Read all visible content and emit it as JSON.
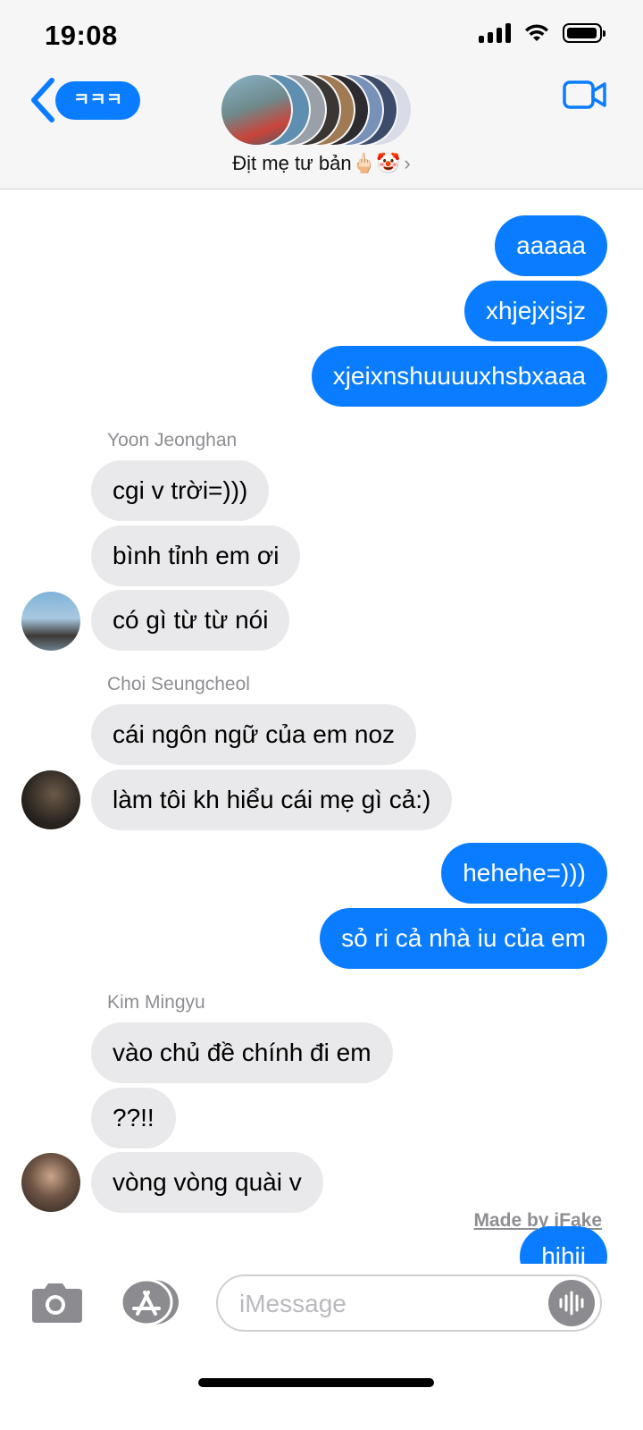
{
  "status": {
    "time": "19:08"
  },
  "header": {
    "back_badge": "ㅋㅋㅋ",
    "group_name": "Địt mẹ tư bản🖕🏻🤡",
    "chevron": "›"
  },
  "messages": [
    {
      "side": "sent",
      "text": "aaaaa"
    },
    {
      "side": "sent",
      "text": "xhjejxjsjz"
    },
    {
      "side": "sent",
      "text": "xjeixnshuuuuxhsbxaaa"
    },
    {
      "side": "sender",
      "text": "Yoon Jeonghan"
    },
    {
      "side": "recv",
      "text": "cgi v trời=)))"
    },
    {
      "side": "recv",
      "text": "bình tỉnh em ơi"
    },
    {
      "side": "recv",
      "text": "có gì từ từ nói"
    },
    {
      "side": "sender",
      "text": "Choi Seungcheol"
    },
    {
      "side": "recv",
      "text": "cái ngôn ngữ của em noz"
    },
    {
      "side": "recv",
      "text": "làm tôi kh hiểu cái mẹ gì cả:)"
    },
    {
      "side": "sent",
      "text": "hehehe=)))"
    },
    {
      "side": "sent",
      "text": "sỏ ri cả nhà iu của em"
    },
    {
      "side": "sender",
      "text": "Kim Mingyu"
    },
    {
      "side": "recv",
      "text": "vào chủ đề chính đi em"
    },
    {
      "side": "recv",
      "text": "??!!"
    },
    {
      "side": "recv",
      "text": "vòng vòng quài v"
    },
    {
      "side": "sent",
      "text": "hihii"
    }
  ],
  "watermark": "Made by iFake",
  "input": {
    "placeholder": "iMessage"
  },
  "icons": {
    "back": "chevron-left-icon",
    "video": "video-camera-icon",
    "camera": "camera-icon",
    "apps": "app-store-icon",
    "audio": "waveform-icon"
  },
  "colors": {
    "sent_bubble": "#0a7cff",
    "recv_bubble": "#e9e9eb",
    "meta_gray": "#8e8e93"
  }
}
